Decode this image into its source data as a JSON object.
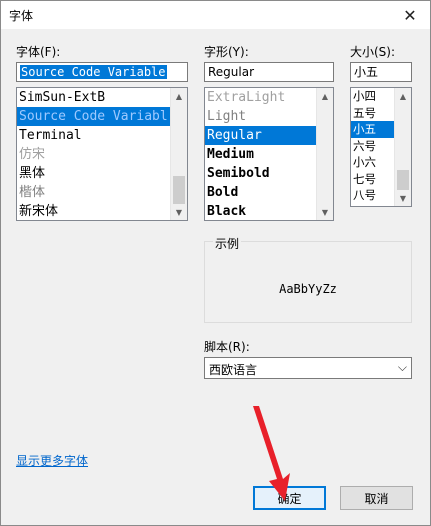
{
  "dialog": {
    "title": "字体",
    "close_glyph": "✕"
  },
  "font": {
    "label": "字体(F):",
    "input_value": "Source Code Variable",
    "items": [
      {
        "text": "SimSun-ExtB",
        "family": "mono",
        "color": "#000000"
      },
      {
        "text": "Source Code Variabl",
        "family": "mono",
        "color": "#ffffff",
        "selected": true
      },
      {
        "text": "Terminal",
        "family": "mono",
        "color": "#000000"
      },
      {
        "text": "仿宋",
        "family": "sans",
        "color": "#a0a0a0"
      },
      {
        "text": "黑体",
        "family": "sans",
        "color": "#000000"
      },
      {
        "text": "楷体",
        "family": "sans",
        "color": "#808080"
      },
      {
        "text": "新宋体",
        "family": "sans",
        "color": "#000000"
      }
    ]
  },
  "style": {
    "label": "字形(Y):",
    "input_value": "Regular",
    "items": [
      {
        "text": "ExtraLight",
        "weight": "200",
        "color": "#a0a0a0"
      },
      {
        "text": "Light",
        "weight": "300",
        "color": "#808080"
      },
      {
        "text": "Regular",
        "weight": "400",
        "color": "#ffffff",
        "selected": true
      },
      {
        "text": "Medium",
        "weight": "600",
        "color": "#000000"
      },
      {
        "text": "Semibold",
        "weight": "700",
        "color": "#000000"
      },
      {
        "text": "Bold",
        "weight": "800",
        "color": "#000000"
      },
      {
        "text": "Black",
        "weight": "900",
        "color": "#000000"
      }
    ]
  },
  "size": {
    "label": "大小(S):",
    "input_value": "小五",
    "items": [
      {
        "text": "小四"
      },
      {
        "text": "五号"
      },
      {
        "text": "小五",
        "selected": true
      },
      {
        "text": "六号"
      },
      {
        "text": "小六"
      },
      {
        "text": "七号"
      },
      {
        "text": "八号"
      }
    ]
  },
  "sample": {
    "legend": "示例",
    "text": "AaBbYyZz"
  },
  "script": {
    "label": "脚本(R):",
    "value": "西欧语言"
  },
  "more_fonts_link": "显示更多字体",
  "buttons": {
    "ok": "确定",
    "cancel": "取消"
  },
  "colors": {
    "selection": "#0078d7",
    "link": "#0066cc",
    "annotation_arrow": "#e8202a"
  }
}
